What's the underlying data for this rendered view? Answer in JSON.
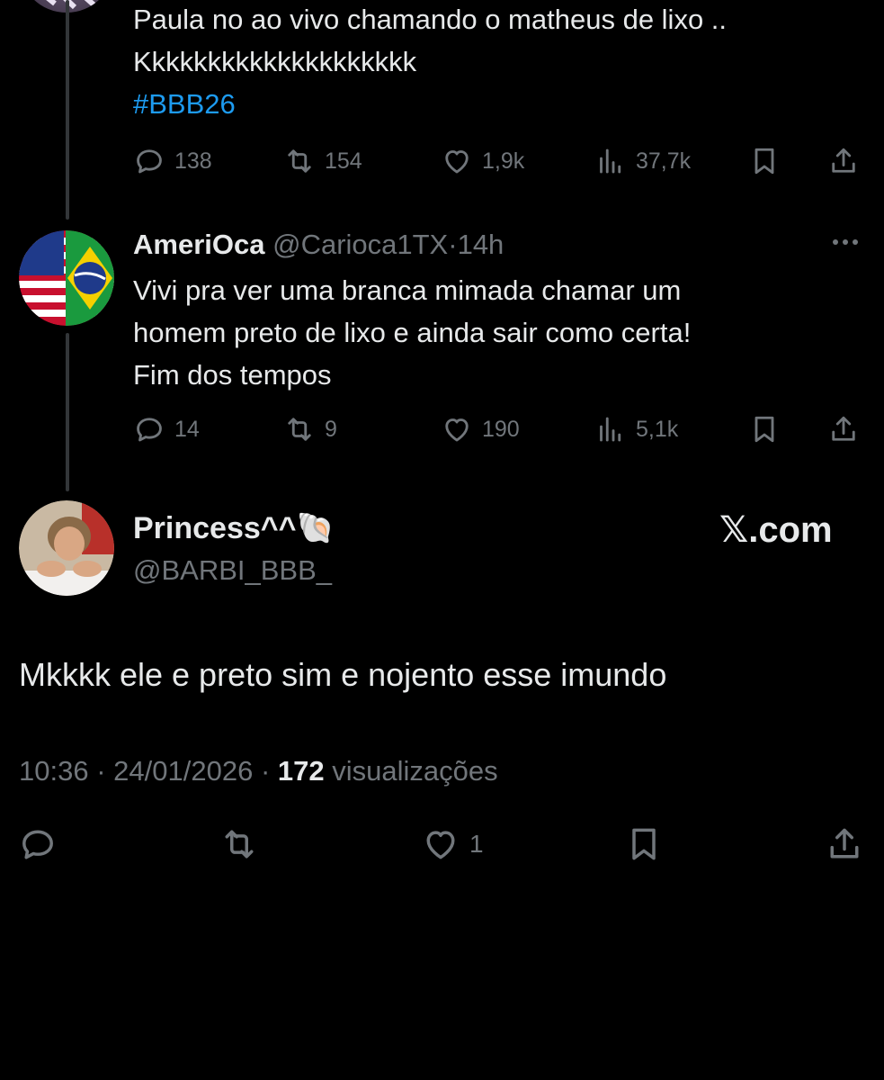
{
  "tweet1": {
    "lines": [
      "Paula no ao vivo chamando o matheus de lixo ..",
      "Kkkkkkkkkkkkkkkkkkkk"
    ],
    "hashtag": "#BBB26",
    "actions": {
      "replies": "138",
      "reposts": "154",
      "likes": "1,9k",
      "views": "37,7k"
    }
  },
  "tweet2": {
    "name": "AmeriOca",
    "handle": "@Carioca1TX",
    "separator": "·",
    "time": "14h",
    "lines": [
      "Vivi pra ver uma branca mimada chamar um",
      "homem preto de lixo e ainda sair como certa!",
      "Fim dos tempos"
    ],
    "actions": {
      "replies": "14",
      "reposts": "9",
      "likes": "190",
      "views": "5,1k"
    }
  },
  "main_tweet": {
    "name": "Princess^^",
    "emoji": "🐚",
    "handle": "@BARBI_BBB_",
    "watermark": "𝕏.com",
    "text": "Mkkkk ele e preto sim e nojento esse imundo",
    "time": "10:36",
    "date": "24/01/2026",
    "separator": "·",
    "views_count": "172",
    "views_label": "visualizações",
    "likes": "1"
  },
  "icons": [
    "reply-icon",
    "repost-icon",
    "like-icon",
    "views-icon",
    "bookmark-icon",
    "share-icon",
    "more-icon"
  ],
  "colors": {
    "background": "#000000",
    "text": "#e7e9ea",
    "muted": "#71767b",
    "link": "#1d9bf0"
  }
}
